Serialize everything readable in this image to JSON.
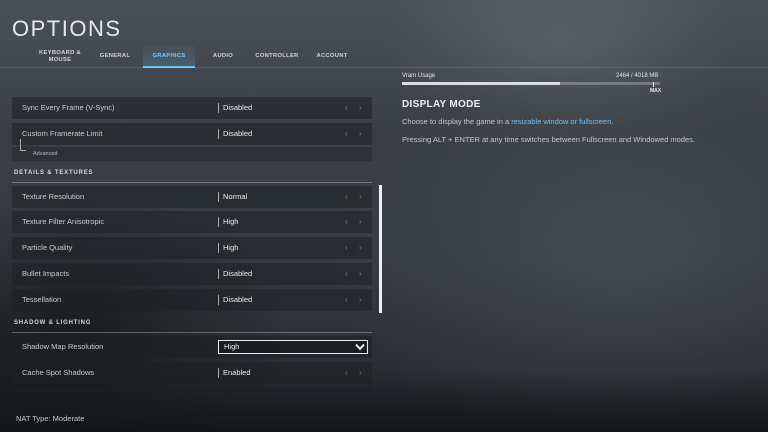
{
  "page": {
    "title": "OPTIONS"
  },
  "tabs": [
    {
      "label": "KEYBOARD & MOUSE",
      "active": false
    },
    {
      "label": "GENERAL",
      "active": false
    },
    {
      "label": "GRAPHICS",
      "active": true
    },
    {
      "label": "AUDIO",
      "active": false
    },
    {
      "label": "CONTROLLER",
      "active": false
    },
    {
      "label": "ACCOUNT",
      "active": false
    }
  ],
  "settings": {
    "vsync": {
      "label": "Sync Every Frame (V-Sync)",
      "value": "Disabled"
    },
    "framerate_limit": {
      "label": "Custom Framerate Limit",
      "value": "Disabled"
    },
    "framerate_sub": {
      "label": "Advanced"
    },
    "section_details": {
      "label": "DETAILS & TEXTURES"
    },
    "texture_resolution": {
      "label": "Texture Resolution",
      "value": "Normal"
    },
    "texture_filter": {
      "label": "Texture Filter Anisotropic",
      "value": "High"
    },
    "particle_quality": {
      "label": "Particle Quality",
      "value": "High"
    },
    "bullet_impacts": {
      "label": "Bullet Impacts",
      "value": "Disabled"
    },
    "tessellation": {
      "label": "Tessellation",
      "value": "Disabled"
    },
    "section_shadow": {
      "label": "SHADOW & LIGHTING"
    },
    "shadow_map": {
      "label": "Shadow Map Resolution",
      "value": "High"
    },
    "cache_spot": {
      "label": "Cache Spot Shadows",
      "value": "Enabled"
    },
    "arrow_left": "‹",
    "arrow_right": "›"
  },
  "info": {
    "vram_label": "Vram Usage",
    "vram_value": "2464 / 4018 MB",
    "vram_fraction": 0.613,
    "vram_max_label": "MAX",
    "title": "DISPLAY MODE",
    "line1_prefix": "Choose to display the game in a ",
    "line1_link": "resizable window or fullscreen",
    "line1_suffix": ".",
    "line2": "Pressing ALT + ENTER at any time switches between Fullscreen and Windowed modes."
  },
  "footer": {
    "nat": "NAT Type: Moderate"
  },
  "colors": {
    "accent": "#6bbcf5",
    "link": "#6fc0f8"
  }
}
